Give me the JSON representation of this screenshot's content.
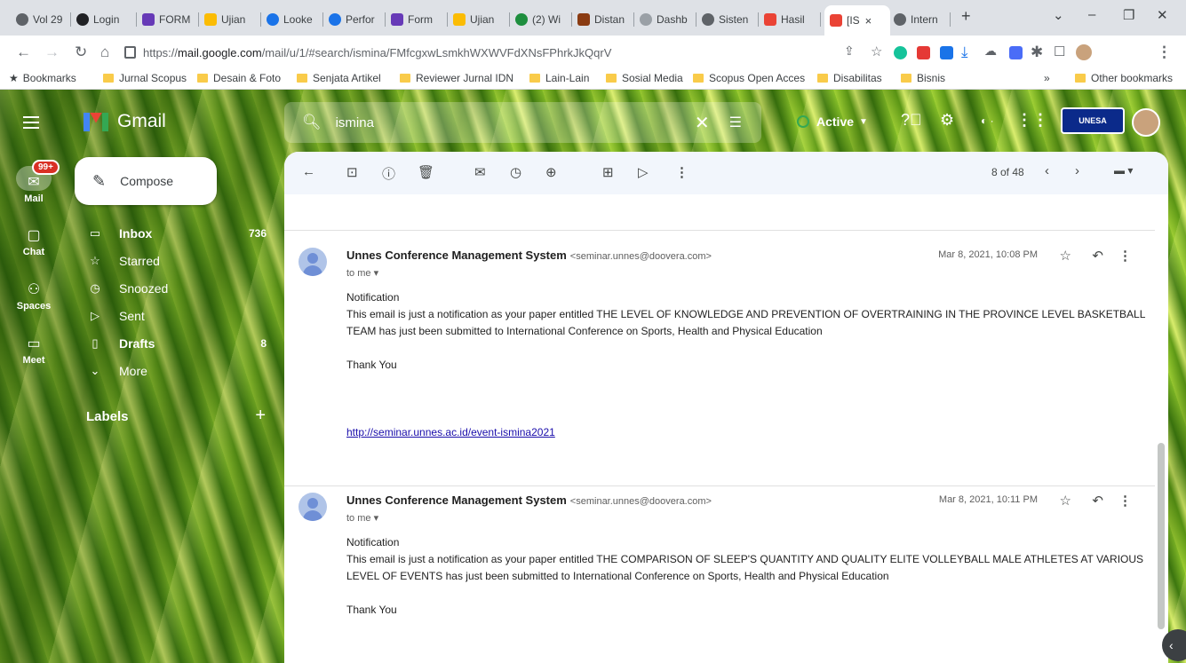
{
  "browser": {
    "tabs": [
      {
        "label": "Vol 29",
        "color": "#5f6368"
      },
      {
        "label": "Login",
        "color": "#202124"
      },
      {
        "label": "FORM",
        "color": "#673ab7"
      },
      {
        "label": "Ujian",
        "color": "#fbbc04"
      },
      {
        "label": "Looke",
        "color": "#1a73e8"
      },
      {
        "label": "Perfor",
        "color": "#1a73e8"
      },
      {
        "label": "Form",
        "color": "#673ab7"
      },
      {
        "label": "Ujian",
        "color": "#fbbc04"
      },
      {
        "label": "(2) Wi",
        "color": "#1e8e3e"
      },
      {
        "label": "Distan",
        "color": "#8a3b12"
      },
      {
        "label": "Dashb",
        "color": "#9aa0a6"
      },
      {
        "label": "Sisten",
        "color": "#5f6368"
      },
      {
        "label": "Hasil",
        "color": "#ea4335"
      },
      {
        "label": "[IS",
        "color": "#ea4335",
        "active": true
      },
      {
        "label": "Intern",
        "color": "#5f6368"
      }
    ],
    "new_tab": "+",
    "close_tab": "×",
    "url": {
      "proto": "https://",
      "host": "mail.google.com",
      "path": "/mail/u/1/#search/ismina/FMfcgxwLsmkhWXWVFdXNsFPhrkJkQqrV"
    },
    "bookmarks_label": "Bookmarks",
    "bookmarks": [
      "Jurnal Scopus",
      "Desain & Foto",
      "Senjata Artikel",
      "Reviewer Jurnal IDN",
      "Lain-Lain",
      "Sosial Media",
      "Scopus Open Acces",
      "Disabilitas",
      "Bisnis"
    ],
    "bookmarks_more": "»",
    "other_bookmarks": "Other bookmarks"
  },
  "gmail": {
    "app_name": "Gmail",
    "search_query": "ismina",
    "status": "Active",
    "badge_text": "UNESA",
    "rail": [
      {
        "label": "Mail",
        "badge": "99+"
      },
      {
        "label": "Chat"
      },
      {
        "label": "Spaces"
      },
      {
        "label": "Meet"
      }
    ],
    "compose": "Compose",
    "nav": [
      {
        "label": "Inbox",
        "count": "736",
        "bold": true,
        "icon": "inbox-icon"
      },
      {
        "label": "Starred",
        "count": "",
        "icon": "star-icon"
      },
      {
        "label": "Snoozed",
        "count": "",
        "icon": "clock-icon"
      },
      {
        "label": "Sent",
        "count": "",
        "icon": "send-icon"
      },
      {
        "label": "Drafts",
        "count": "8",
        "bold": true,
        "icon": "draft-icon"
      },
      {
        "label": "More",
        "count": "",
        "icon": "chevron-down-icon"
      }
    ],
    "labels_header": "Labels",
    "pager": "8 of 48",
    "messages": [
      {
        "sender": "Unnes Conference Management System",
        "email": "<seminar.unnes@doovera.com>",
        "to": "to me ▾",
        "date": "Mar 8, 2021, 10:08 PM",
        "line1": "Notification",
        "line2": "This email is just a notification as your paper entitled THE LEVEL OF KNOWLEDGE AND PREVENTION OF OVERTRAINING IN THE PROVINCE LEVEL BASKETBALL TEAM has just been submitted to International Conference on Sports, Health and Physical Education",
        "thanks": "Thank You",
        "link": "http://seminar.unnes.ac.id/event-ismina2021"
      },
      {
        "sender": "Unnes Conference Management System",
        "email": "<seminar.unnes@doovera.com>",
        "to": "to me ▾",
        "date": "Mar 8, 2021, 10:11 PM",
        "line1": "Notification",
        "line2": "This email is just a notification as your paper entitled THE COMPARISON OF SLEEP'S QUANTITY AND QUALITY ELITE VOLLEYBALL MALE ATHLETES AT VARIOUS LEVEL OF EVENTS has just been submitted to International Conference on Sports, Health and Physical Education",
        "thanks": "Thank You"
      }
    ]
  }
}
